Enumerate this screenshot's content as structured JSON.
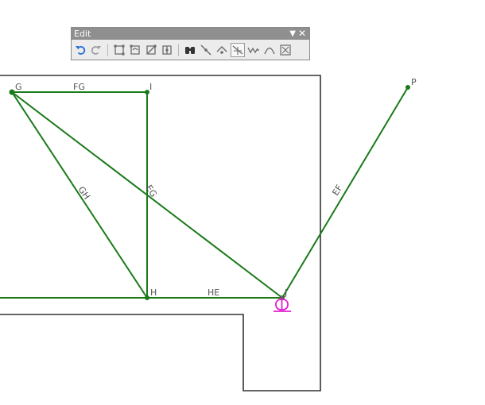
{
  "toolbar": {
    "title": "Edit",
    "tools": [
      {
        "name": "undo-icon",
        "color": "#2a6fd6"
      },
      {
        "name": "redo-icon",
        "color": "#9a9a9a"
      },
      {
        "name": "separator"
      },
      {
        "name": "edit-vertices-icon",
        "color": "#6a6a6a"
      },
      {
        "name": "reshape-feature-icon",
        "color": "#6a6a6a"
      },
      {
        "name": "cut-polygons-icon",
        "color": "#6a6a6a"
      },
      {
        "name": "split-tool-icon",
        "color": "#6a6a6a"
      },
      {
        "name": "separator"
      },
      {
        "name": "binoculars-icon",
        "color": "#333333"
      },
      {
        "name": "measure-line-icon",
        "color": "#6a6a6a"
      },
      {
        "name": "rotate-icon",
        "color": "#6a6a6a"
      },
      {
        "name": "select-vertex-icon",
        "color": "#6a6a6a",
        "active": true
      },
      {
        "name": "generalize-icon",
        "color": "#6a6a6a"
      },
      {
        "name": "smooth-icon",
        "color": "#6a6a6a"
      },
      {
        "name": "topology-icon",
        "color": "#6a6a6a"
      }
    ]
  },
  "colors": {
    "edge": "#1a7a1a",
    "boundary": "#333333",
    "selection": "#e020d0"
  },
  "nodes": {
    "G": "G",
    "I": "I",
    "H": "H",
    "J": "J",
    "P": "P"
  },
  "edges": {
    "FG": "FG",
    "GH": "GH",
    "EG": "EG",
    "HE": "HE",
    "EF": "EF"
  }
}
